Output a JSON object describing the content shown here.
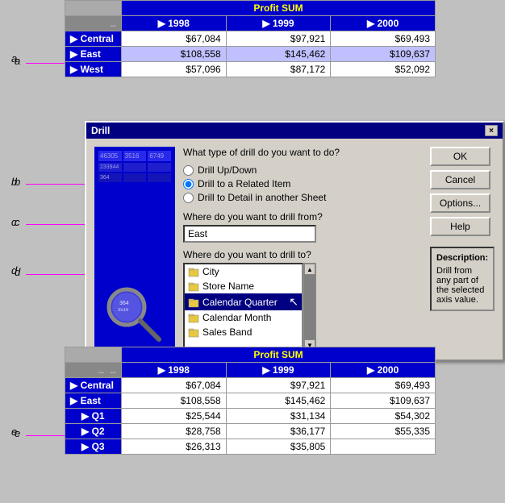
{
  "labels": {
    "a": "a",
    "b": "b",
    "c": "c",
    "d": "d",
    "e": "e"
  },
  "top_table": {
    "header": "Profit SUM",
    "years": [
      "1998",
      "1999",
      "2000"
    ],
    "rows": [
      {
        "name": "Central",
        "vals": [
          "$67,084",
          "$97,921",
          "$69,493"
        ],
        "selected": false
      },
      {
        "name": "East",
        "vals": [
          "$108,558",
          "$145,462",
          "$109,637"
        ],
        "selected": true
      },
      {
        "name": "West",
        "vals": [
          "$57,096",
          "$87,172",
          "$52,092"
        ],
        "selected": false
      }
    ]
  },
  "dialog": {
    "title": "Drill",
    "close_btn": "×",
    "question1": "What type of drill do you want to do?",
    "radios": [
      {
        "id": "r1",
        "label": "Drill Up/Down",
        "checked": false
      },
      {
        "id": "r2",
        "label": "Drill to a Related Item",
        "checked": true
      },
      {
        "id": "r3",
        "label": "Drill to Detail in another Sheet",
        "checked": false
      }
    ],
    "question2": "Where do you want to drill from?",
    "drill_from_value": "East",
    "question3": "Where do you want to drill to?",
    "drill_items": [
      {
        "label": "City",
        "icon": "folder"
      },
      {
        "label": "Store Name",
        "icon": "folder"
      },
      {
        "label": "Calendar Quarter",
        "icon": "folder",
        "selected": true
      },
      {
        "label": "Calendar Month",
        "icon": "folder"
      },
      {
        "label": "Sales Band",
        "icon": "folder"
      }
    ],
    "buttons": [
      "OK",
      "Cancel",
      "Options...",
      "Help"
    ],
    "description_title": "Description:",
    "description_text": "Drill from any part of the selected axis value."
  },
  "bottom_table": {
    "header": "Profit SUM",
    "years": [
      "1998",
      "1999",
      "2000"
    ],
    "rows": [
      {
        "name": "Central",
        "vals": [
          "$67,084",
          "$97,921",
          "$69,493"
        ],
        "indent": false
      },
      {
        "name": "East",
        "vals": [
          "$108,558",
          "$145,462",
          "$109,637"
        ],
        "indent": false,
        "expanded": true
      },
      {
        "name": "Q1",
        "vals": [
          "$25,544",
          "$31,134",
          "$54,302"
        ],
        "indent": true
      },
      {
        "name": "Q2",
        "vals": [
          "$28,758",
          "$36,177",
          "$55,335"
        ],
        "indent": true
      },
      {
        "name": "Q3",
        "vals": [
          "$26,313",
          "$35,805",
          ""
        ],
        "indent": true
      }
    ]
  }
}
